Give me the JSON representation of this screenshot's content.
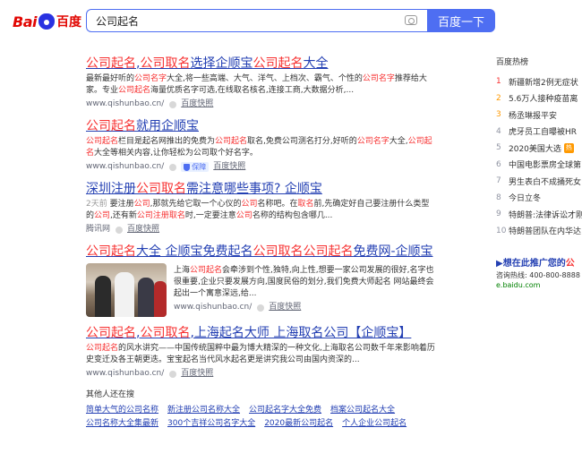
{
  "header": {
    "logo_left": "Bai",
    "logo_right": "百度",
    "query": "公司起名",
    "search_button": "百度一下"
  },
  "results": [
    {
      "title": [
        "",
        "公司起名",
        ",",
        "公司取名",
        "选择企顺宝",
        "公司起名",
        "大全"
      ],
      "abstract": [
        "最新最好听的",
        "公司名字",
        "大全,将一些高端、大气、洋气、上档次、霸气、个性的",
        "公司名字",
        "推荐给大家。专业",
        "公司起名",
        "海量优质名字可选,在线取名核名,连接工商,大数据分析,..."
      ],
      "url": "www.qishunbao.cn/",
      "snapshot": "百度快照"
    },
    {
      "title": [
        "",
        "公司起名",
        "就用企顺宝"
      ],
      "abstract": [
        "",
        "公司起名",
        "栏目是起名网推出的免费为",
        "公司起名",
        "取名,免费公司测名打分,好听的",
        "公司名字",
        "大全,",
        "公司起名",
        "大全等相关内容,让你轻松为公司取个好名字。"
      ],
      "url": "www.qishunbao.cn/",
      "badge": "保障",
      "snapshot": "百度快照"
    },
    {
      "title": [
        "深圳注册",
        "公司取名",
        "需注意哪些事项?  企顺宝"
      ],
      "time": "2天前",
      "abstract": [
        " 要注册",
        "公司",
        ",那就先给它取一个心仪的",
        "公司",
        "名称吧。在",
        "取名",
        "前,先确定好自己要注册什么类型的",
        "公司",
        ",还有新",
        "公司注册取名",
        "时,一定要注意",
        "公司",
        "名称的结构包含哪几..."
      ],
      "url": "腾讯网",
      "snapshot": "百度快照"
    },
    {
      "title": [
        "",
        "公司起名",
        "大全 企顺宝免费起名",
        "公司取名公司起名",
        "免费网-企顺宝"
      ],
      "abstract": [
        "上海",
        "公司起名",
        "会牵涉到个性,独特,向上性,想要一家公司发展的很好,名字也很重要,企业只要发展方向,国度民俗的划分,我们免费大师起名 网站最终会起出一个寓意深远,给..."
      ],
      "url": "www.qishunbao.cn/",
      "snapshot": "百度快照"
    },
    {
      "title": [
        "",
        "公司起名",
        ",",
        "公司取名",
        ",上海起名大师 上海取名公司【企顺宝】"
      ],
      "abstract": [
        "",
        "公司起名",
        "的风水讲究——中国传统国粹中最为博大精深的一种文化,上海取名公司数千年来影响着历史变迁及各王朝更迭。宝宝起名当代风水起名更是讲究我公司由国内资深的..."
      ],
      "url": "www.qishunbao.cn/",
      "snapshot": "百度快照"
    }
  ],
  "related": {
    "title": "其他人还在搜",
    "rows": [
      [
        "简单大气的公司名称",
        "新注册公司名称大全",
        "公司起名字大全免费",
        "档案公司起名大全"
      ],
      [
        "公司名称大全集最新",
        "300个吉祥公司名字大全",
        "2020最新公司起名",
        "个人企业公司起名"
      ]
    ]
  },
  "sidebar": {
    "hot_title": "百度热榜",
    "hot": [
      {
        "num": "1",
        "text": "新疆新增2例无症状"
      },
      {
        "num": "2",
        "text": "5.6万人接种疫苗离"
      },
      {
        "num": "3",
        "text": "杨丞琳报平安"
      },
      {
        "num": "4",
        "text": "虎牙员工自曝被HR"
      },
      {
        "num": "5",
        "text": "2020美国大选",
        "tag": "热"
      },
      {
        "num": "6",
        "text": "中国电影票房全球第"
      },
      {
        "num": "7",
        "text": "男生表白不成捅死女"
      },
      {
        "num": "8",
        "text": "今日立冬"
      },
      {
        "num": "9",
        "text": "特朗普:法律诉讼才刚"
      },
      {
        "num": "10",
        "text": "特朗普团队在内华达"
      }
    ],
    "ad_title_pre": "▶想在此推广您的",
    "ad_title_em": "公",
    "ad_phone": "咨询热线: 400-800-8888",
    "ad_url": "e.baidu.com"
  },
  "colors": {
    "brand_blue": "#4e6ef2",
    "link_blue": "#2440b3",
    "highlight_red": "#f73131",
    "hot_orange": "#ff9a02",
    "green_url": "#008000"
  },
  "icons": [
    "baidu-paw-icon",
    "camera-icon",
    "shield-icon",
    "dot-icon"
  ]
}
